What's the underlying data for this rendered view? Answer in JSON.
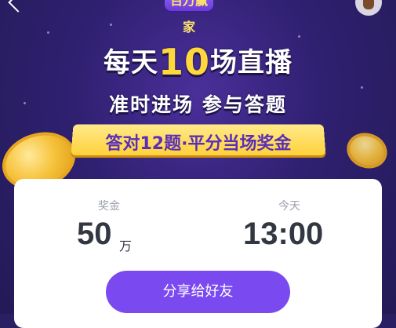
{
  "header": {
    "logo_text": "百万赢家"
  },
  "banner": {
    "line1_prefix": "每天",
    "line1_number": "10",
    "line1_suffix": "场直播",
    "line2": "准时进场  参与答题",
    "ribbon": "答对12题·平分当场奖金"
  },
  "card": {
    "prize_label": "奖金",
    "prize_value": "50",
    "prize_unit": "万",
    "time_label": "今天",
    "time_value": "13:00",
    "share_button": "分享给好友"
  },
  "colors": {
    "background": "#2b1f63",
    "highlight": "#ffd93b",
    "button": "#7a4af0"
  }
}
